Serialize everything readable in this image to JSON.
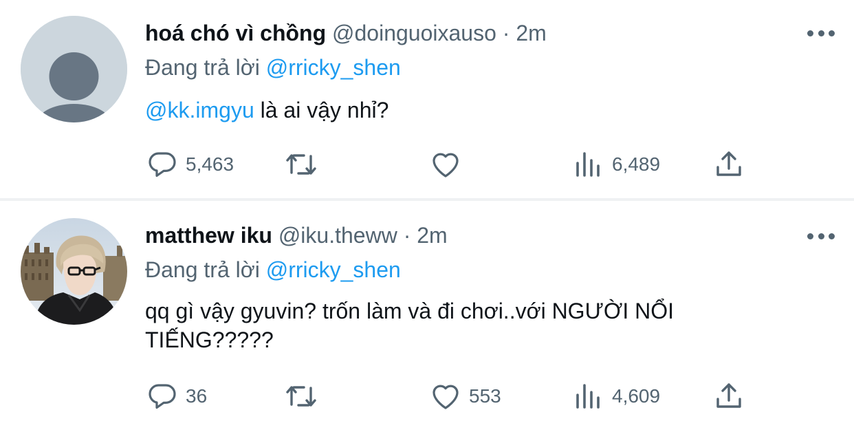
{
  "tweets": [
    {
      "name": "hoá chó vì chồng",
      "handle": "@doinguoixauso",
      "separator": "·",
      "time": "2m",
      "reply_prefix": "Đang trả lời",
      "reply_to": "@rricky_shen",
      "text_mention": "@kk.imgyu",
      "text": " là ai vậy nhỉ?",
      "reply_count": "5,463",
      "retweet_count": "",
      "like_count": "",
      "view_count": "6,489",
      "avatar": "default-avatar-icon"
    },
    {
      "name": "matthew iku",
      "handle": "@iku.theww",
      "separator": "·",
      "time": "2m",
      "reply_prefix": "Đang trả lời",
      "reply_to": "@rricky_shen",
      "text": "qq gì vậy gyuvin? trốn làm và đi chơi..với NGƯỜI NỔI TIẾNG?????",
      "reply_count": "36",
      "retweet_count": "",
      "like_count": "553",
      "view_count": "4,609",
      "avatar": "profile-photo"
    }
  ],
  "colors": {
    "text_primary": "#0f1419",
    "text_secondary": "#536471",
    "link": "#1d9bf0",
    "divider": "#eff1f3",
    "default_avatar_bg": "#ccd6dd",
    "default_avatar_fg": "#687684"
  }
}
